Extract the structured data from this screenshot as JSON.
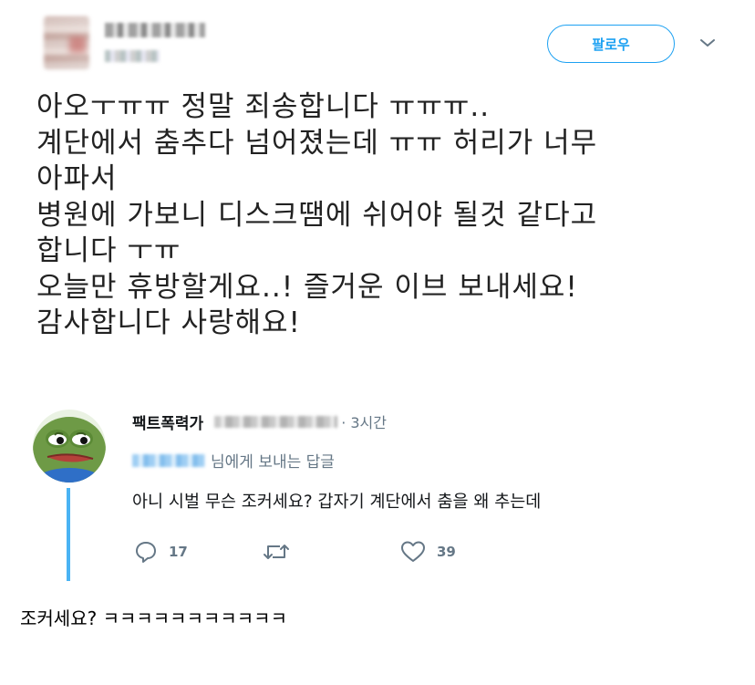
{
  "tweet": {
    "follow_label": "팔로우",
    "text": "아오ㅜㅠㅠ 정말 죄송합니다 ㅠㅠㅠ..\n계단에서 춤추다 넘어졌는데 ㅠㅠ 허리가 너무\n아파서\n병원에 가보니 디스크땜에 쉬어야 될것 같다고\n합니다 ㅜㅠ\n오늘만 휴방할게요..! 즐거운 이브 보내세요!\n감사합니다 사랑해요!"
  },
  "reply": {
    "name": "팩트폭력가",
    "time": "· 3시간",
    "replying_to_suffix": "님에게 보내는 답글",
    "text": "아니 시벌 무슨 조커세요? 갑자기 계단에서 춤을 왜 추는데",
    "actions": {
      "reply_count": "17",
      "like_count": "39"
    }
  },
  "caption": "조커세요? ㅋㅋㅋㅋㅋㅋㅋㅋㅋㅋㅋ",
  "colors": {
    "accent": "#1da1f2",
    "muted": "#657786",
    "thread": "#4ab3f4"
  },
  "icons": [
    "chevron-down-icon",
    "reply-icon",
    "retweet-icon",
    "like-icon"
  ]
}
